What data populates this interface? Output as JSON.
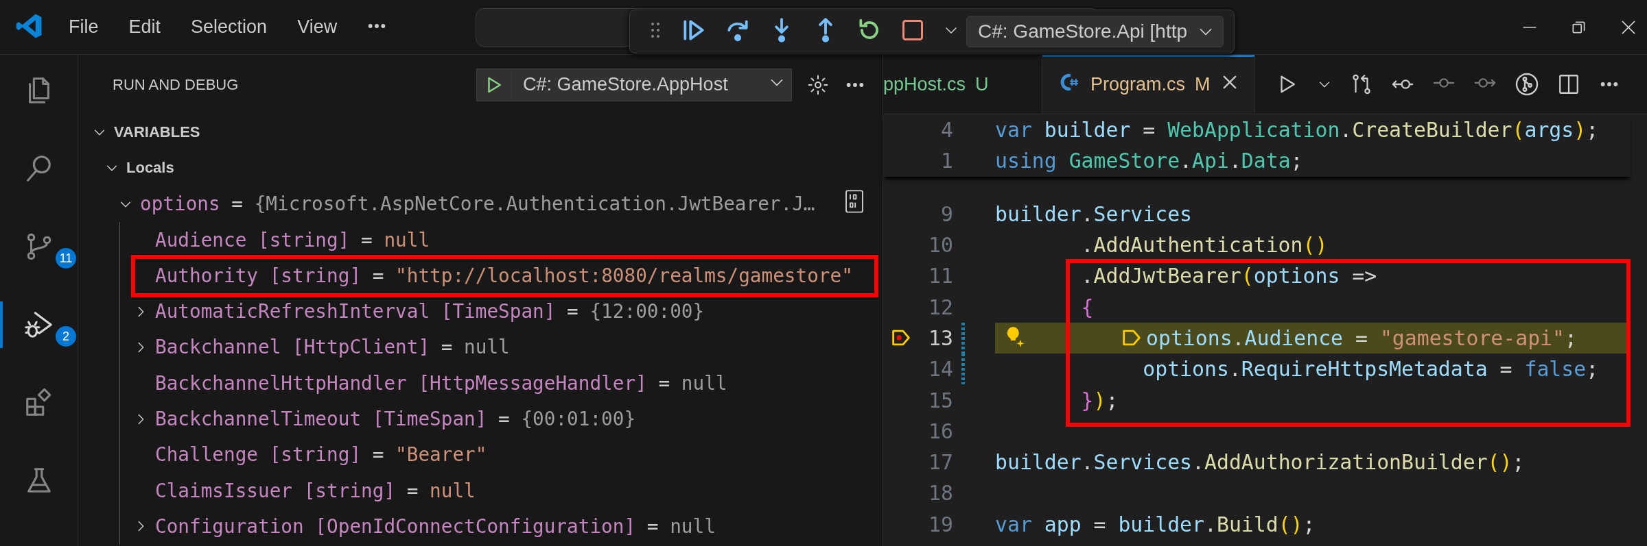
{
  "title_bar": {
    "menus": [
      {
        "label": "File"
      },
      {
        "label": "Edit"
      },
      {
        "label": "Selection"
      },
      {
        "label": "View"
      }
    ]
  },
  "debug_toolbar": {
    "config": "C#: GameStore.Api [http"
  },
  "activity_bar": {
    "items": [
      {
        "kind": "explorer",
        "selected": false
      },
      {
        "kind": "search",
        "selected": false
      },
      {
        "kind": "source_control",
        "selected": false,
        "badge": "11"
      },
      {
        "kind": "run_debug",
        "selected": true,
        "badge": "2"
      },
      {
        "kind": "extensions",
        "selected": false
      },
      {
        "kind": "testing",
        "selected": false
      }
    ]
  },
  "sidebar": {
    "title": "RUN AND DEBUG",
    "launch_config": "C#: GameStore.AppHost",
    "variables": {
      "title": "VARIABLES",
      "expanded": true,
      "scopes": [
        {
          "name": "Locals",
          "expanded": true,
          "children": [
            {
              "label": "options",
              "sep": "=",
              "value": "{Microsoft.AspNetCore.Authentication.JwtBearer.J…",
              "color": "#9d9d9d",
              "expanded": true,
              "boxed": false,
              "children": [
                {
                  "label": "Audience [string]",
                  "sep": "=",
                  "value": "null",
                  "color": "#ce9178",
                  "boxed": false
                },
                {
                  "label": "Authority [string]",
                  "sep": "=",
                  "value": "\"http://localhost:8080/realms/gamestore\"",
                  "color": "#ce9178",
                  "boxed": true
                },
                {
                  "label": "AutomaticRefreshInterval [TimeSpan]",
                  "sep": "=",
                  "value": "{12:00:00}",
                  "color": "#9d9d9d",
                  "expanded": false,
                  "boxed": false
                },
                {
                  "label": "Backchannel [HttpClient]",
                  "sep": "=",
                  "value": "null",
                  "color": "#9d9d9d",
                  "expanded": false,
                  "boxed": false
                },
                {
                  "label": "BackchannelHttpHandler [HttpMessageHandler]",
                  "sep": "=",
                  "value": "null",
                  "color": "#9d9d9d",
                  "boxed": false
                },
                {
                  "label": "BackchannelTimeout [TimeSpan]",
                  "sep": "=",
                  "value": "{00:01:00}",
                  "color": "#9d9d9d",
                  "expanded": false,
                  "boxed": false
                },
                {
                  "label": "Challenge [string]",
                  "sep": "=",
                  "value": "\"Bearer\"",
                  "color": "#ce9178",
                  "boxed": false
                },
                {
                  "label": "ClaimsIssuer [string]",
                  "sep": "=",
                  "value": "null",
                  "color": "#ce9178",
                  "boxed": false
                },
                {
                  "label": "Configuration [OpenIdConnectConfiguration]",
                  "sep": "=",
                  "value": "null",
                  "color": "#9d9d9d",
                  "expanded": false,
                  "boxed": false
                }
              ]
            }
          ]
        }
      ]
    }
  },
  "editor": {
    "tabs": [
      {
        "label": "ppHost.cs",
        "status": "U",
        "color": "#73c991",
        "selected": false,
        "icon": false
      },
      {
        "label": "Program.cs",
        "status": "M",
        "color": "#e2c08d",
        "selected": true,
        "icon": true
      }
    ],
    "sticky_lines": [
      {
        "number": "4",
        "tokens": [
          {
            "text": "var",
            "kind": "keyword"
          },
          {
            "text": " builder",
            "kind": "variable"
          },
          {
            "text": " = ",
            "kind": "punct"
          },
          {
            "text": "WebApplication",
            "kind": "type"
          },
          {
            "text": ".",
            "kind": "punct"
          },
          {
            "text": "CreateBuilder",
            "kind": "method"
          },
          {
            "text": "(",
            "kind": "bracket1"
          },
          {
            "text": "args",
            "kind": "variable"
          },
          {
            "text": ")",
            "kind": "bracket1"
          },
          {
            "text": ";",
            "kind": "punct"
          }
        ]
      },
      {
        "number": "1",
        "tokens": [
          {
            "text": "using",
            "kind": "keyword"
          },
          {
            "text": " GameStore",
            "kind": "type"
          },
          {
            "text": ".",
            "kind": "punct"
          },
          {
            "text": "Api",
            "kind": "type"
          },
          {
            "text": ".",
            "kind": "punct"
          },
          {
            "text": "Data",
            "kind": "type"
          },
          {
            "text": ";",
            "kind": "punct"
          }
        ]
      }
    ],
    "lines": [
      {
        "number": "9",
        "current": false,
        "breakpoint": false,
        "modified": false,
        "lightbulb": false,
        "boxed": false,
        "tokens": [
          {
            "text": "builder",
            "kind": "variable"
          },
          {
            "text": ".",
            "kind": "punct"
          },
          {
            "text": "Services",
            "kind": "variable"
          }
        ]
      },
      {
        "number": "10",
        "current": false,
        "breakpoint": false,
        "modified": false,
        "lightbulb": false,
        "boxed": false,
        "tokens": [
          {
            "text": "       .",
            "kind": "punct"
          },
          {
            "text": "AddAuthentication",
            "kind": "method"
          },
          {
            "text": "()",
            "kind": "bracket1"
          }
        ]
      },
      {
        "number": "11",
        "current": false,
        "breakpoint": false,
        "modified": false,
        "lightbulb": false,
        "boxed": true,
        "tokens": [
          {
            "text": "       .",
            "kind": "punct"
          },
          {
            "text": "AddJwtBearer",
            "kind": "method"
          },
          {
            "text": "(",
            "kind": "bracket1"
          },
          {
            "text": "options",
            "kind": "variable"
          },
          {
            "text": " =>",
            "kind": "punct"
          }
        ]
      },
      {
        "number": "12",
        "current": false,
        "breakpoint": false,
        "modified": false,
        "lightbulb": false,
        "boxed": true,
        "tokens": [
          {
            "text": "       {",
            "kind": "bracket2"
          }
        ]
      },
      {
        "number": "13",
        "current": true,
        "breakpoint": true,
        "modified": true,
        "lightbulb": true,
        "boxed": true,
        "tokens": [
          {
            "kind": "stop_marker"
          },
          {
            "text": "options",
            "kind": "variable"
          },
          {
            "text": ".",
            "kind": "punct"
          },
          {
            "text": "Audience",
            "kind": "variable"
          },
          {
            "text": " = ",
            "kind": "punct"
          },
          {
            "text": "\"gamestore-api\"",
            "kind": "string"
          },
          {
            "text": ";",
            "kind": "punct"
          }
        ]
      },
      {
        "number": "14",
        "current": false,
        "breakpoint": false,
        "modified": true,
        "lightbulb": false,
        "boxed": true,
        "tokens": [
          {
            "text": "            options",
            "kind": "variable"
          },
          {
            "text": ".",
            "kind": "punct"
          },
          {
            "text": "RequireHttpsMetadata",
            "kind": "variable"
          },
          {
            "text": " = ",
            "kind": "punct"
          },
          {
            "text": "false",
            "kind": "keyword"
          },
          {
            "text": ";",
            "kind": "punct"
          }
        ]
      },
      {
        "number": "15",
        "current": false,
        "breakpoint": false,
        "modified": false,
        "lightbulb": false,
        "boxed": true,
        "tokens": [
          {
            "text": "       }",
            "kind": "bracket2"
          },
          {
            "text": ")",
            "kind": "bracket1"
          },
          {
            "text": ";",
            "kind": "punct"
          }
        ]
      },
      {
        "number": "16",
        "current": false,
        "breakpoint": false,
        "modified": false,
        "lightbulb": false,
        "boxed": false
      },
      {
        "number": "17",
        "current": false,
        "breakpoint": false,
        "modified": false,
        "lightbulb": false,
        "boxed": false,
        "tokens": [
          {
            "text": "builder",
            "kind": "variable"
          },
          {
            "text": ".",
            "kind": "punct"
          },
          {
            "text": "Services",
            "kind": "variable"
          },
          {
            "text": ".",
            "kind": "punct"
          },
          {
            "text": "AddAuthorizationBuilder",
            "kind": "method"
          },
          {
            "text": "()",
            "kind": "bracket1"
          },
          {
            "text": ";",
            "kind": "punct"
          }
        ]
      },
      {
        "number": "18",
        "current": false,
        "breakpoint": false,
        "modified": false,
        "lightbulb": false,
        "boxed": false
      },
      {
        "number": "19",
        "current": false,
        "breakpoint": false,
        "modified": false,
        "lightbulb": false,
        "boxed": false,
        "tokens": [
          {
            "text": "var",
            "kind": "keyword"
          },
          {
            "text": " app",
            "kind": "variable"
          },
          {
            "text": " = ",
            "kind": "punct"
          },
          {
            "text": "builder",
            "kind": "variable"
          },
          {
            "text": ".",
            "kind": "punct"
          },
          {
            "text": "Build",
            "kind": "method"
          },
          {
            "text": "()",
            "kind": "bracket1"
          },
          {
            "text": ";",
            "kind": "punct"
          }
        ]
      }
    ]
  }
}
